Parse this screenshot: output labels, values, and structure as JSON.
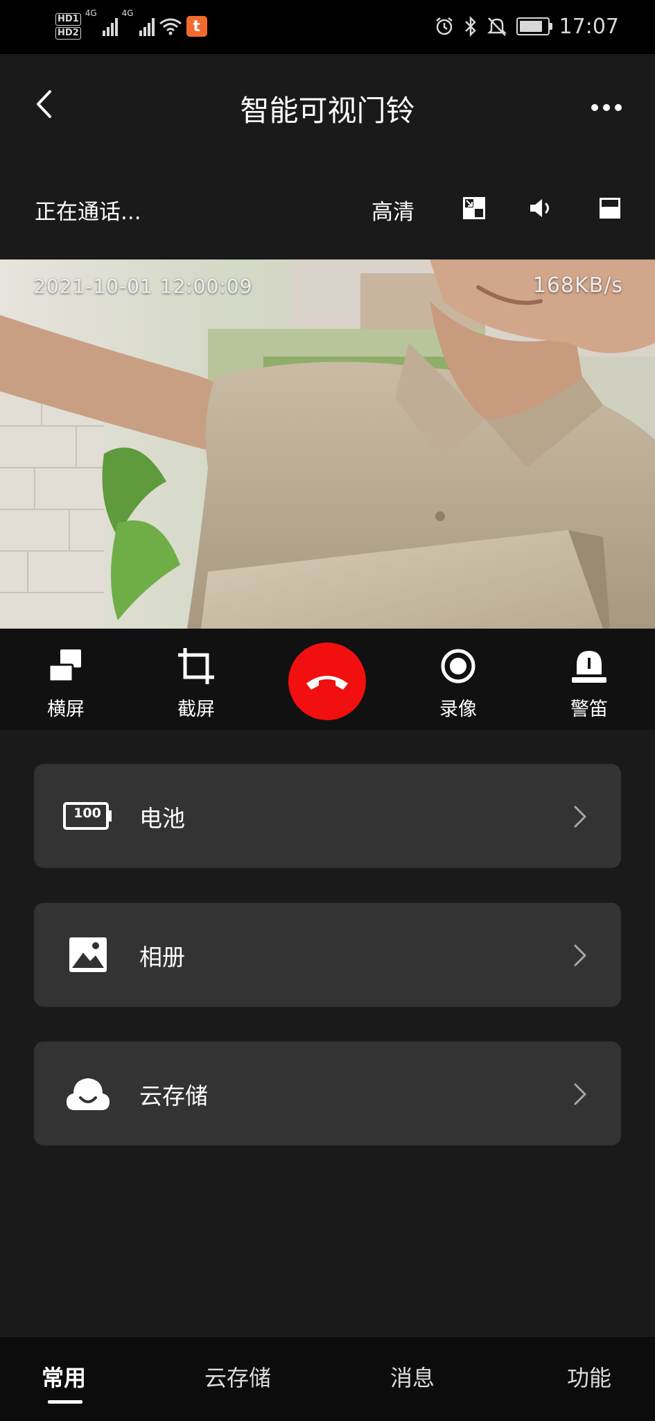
{
  "status_bar": {
    "hd_badges": [
      "HD1",
      "HD2"
    ],
    "network_labels": [
      "4G",
      "4G"
    ],
    "app_badge": "t",
    "time": "17:07",
    "icons": [
      "alarm-icon",
      "bluetooth-icon",
      "mute-icon",
      "battery-icon"
    ]
  },
  "header": {
    "title": "智能可视门铃",
    "back_icon": "chevron-left-icon",
    "more_icon": "more-dots-icon"
  },
  "call_bar": {
    "status": "正在通话...",
    "quality": "高清",
    "icons": [
      "split-screen-icon",
      "speaker-icon",
      "fullscreen-icon"
    ]
  },
  "video": {
    "timestamp": "2021-10-01  12:00:09",
    "bitrate": "168KB/s"
  },
  "controls": [
    {
      "label": "横屏",
      "icon": "landscape-icon"
    },
    {
      "label": "截屏",
      "icon": "screenshot-icon"
    },
    {
      "label": "",
      "icon": "hangup-icon"
    },
    {
      "label": "录像",
      "icon": "record-icon"
    },
    {
      "label": "警笛",
      "icon": "siren-icon"
    }
  ],
  "menu": [
    {
      "label": "电池",
      "icon": "battery-icon",
      "badge": "100"
    },
    {
      "label": "相册",
      "icon": "photo-album-icon"
    },
    {
      "label": "云存储",
      "icon": "cloud-storage-icon"
    }
  ],
  "tabs": [
    {
      "label": "常用",
      "active": true
    },
    {
      "label": "云存储",
      "active": false
    },
    {
      "label": "消息",
      "active": false
    },
    {
      "label": "功能",
      "active": false
    }
  ],
  "colors": {
    "background": "#1a1a1a",
    "card": "#333333",
    "hangup": "#f10f0f",
    "tabbar": "#0c0c0c"
  }
}
